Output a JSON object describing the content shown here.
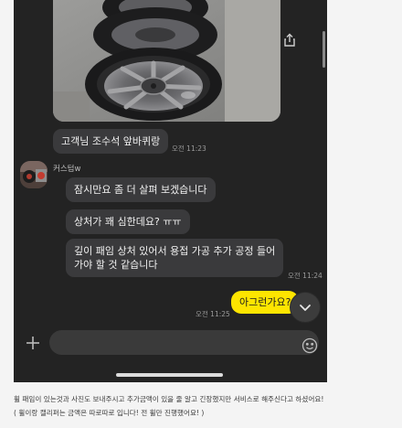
{
  "chat": {
    "messages": {
      "m1": "고객님 조수석 앞바퀴랑",
      "m2": "잠시만요 좀 더 살펴 보겠습니다",
      "m3": "상처가 꽤 심한데요? ㅠㅠ",
      "m4_line1": "깊이 패임 상처 있어서 용접 가공 추가 공정 들어",
      "m4_line2": "가야 할 것 같습니다",
      "mine": "아그런가요?"
    },
    "times": {
      "t1": "오전 11:23",
      "t2": "오전 11:24",
      "t3": "오전 11:25"
    },
    "sender_name": "커스텀w"
  },
  "composer": {
    "hash_label": "#"
  },
  "caption": {
    "line1": "휠 패임이 있는것과 사진도 보내주시고 추가금액이 있을 줄 알고 긴장했지만 서비스로 해주신다고 하셨어요!",
    "line2": "( 휠이랑 캘리퍼는 금액은 따로따로 입니다! 전 휠만 진행했어요! )"
  },
  "colors": {
    "chat_bg": "#232323",
    "bubble_other": "#3a3a3c",
    "bubble_mine": "#fee500"
  },
  "icons": [
    "share-icon",
    "chevron-down-icon",
    "plus-icon",
    "emoji-icon",
    "hash-icon"
  ]
}
